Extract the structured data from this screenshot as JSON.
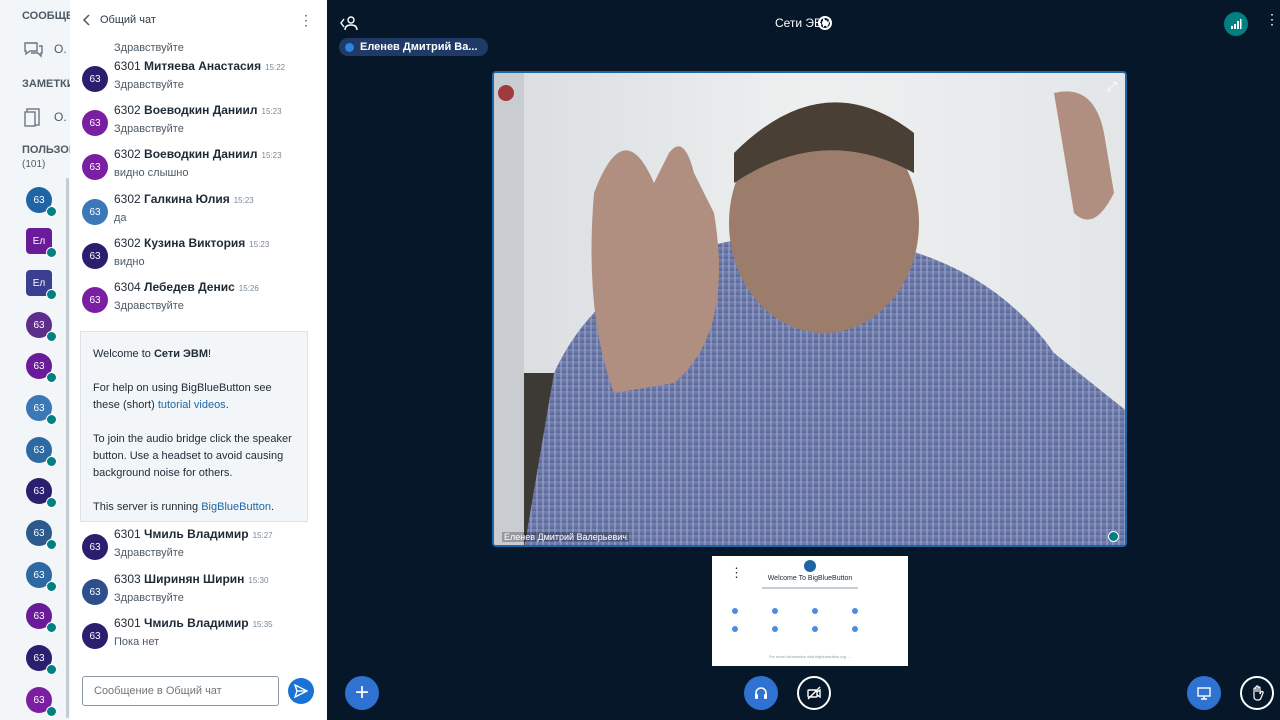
{
  "sidebar": {
    "messages_header": "СООБЩЕН",
    "messages_item_label": "О.",
    "notes_header": "ЗАМЕТКИ",
    "notes_item_label": "О.",
    "users_header": "ПОЛЬЗОВ",
    "users_count": "(101)",
    "users": [
      {
        "initials": "63",
        "color": "#1f65a6"
      },
      {
        "initials": "Ел",
        "color": "#6a1b9a"
      },
      {
        "initials": "Ел",
        "color": "#3b3f8f"
      },
      {
        "initials": "63",
        "color": "#5e2e8c"
      },
      {
        "initials": "63",
        "color": "#6a1b9a"
      },
      {
        "initials": "63",
        "color": "#3a78b8"
      },
      {
        "initials": "63",
        "color": "#2d6aa3"
      },
      {
        "initials": "63",
        "color": "#2a1f6e"
      },
      {
        "initials": "63",
        "color": "#2d5a8c"
      },
      {
        "initials": "63",
        "color": "#2d6aa3"
      },
      {
        "initials": "63",
        "color": "#6a1b9a"
      },
      {
        "initials": "63",
        "color": "#2a1f6e"
      },
      {
        "initials": "63",
        "color": "#7b1fa2"
      }
    ]
  },
  "chat": {
    "title": "Общий чат",
    "cut_message": "Здравствуйте",
    "messages": [
      {
        "initials": "63",
        "color": "#2a1f6e",
        "group": "6301",
        "name": "Митяева Анастасия",
        "time": "15:22",
        "text": "Здравствуйте"
      },
      {
        "initials": "63",
        "color": "#7b1fa2",
        "group": "6302",
        "name": "Воеводкин Даниил",
        "time": "15:23",
        "text": "Здравствуйте"
      },
      {
        "initials": "63",
        "color": "#7b1fa2",
        "group": "6302",
        "name": "Воеводкин Даниил",
        "time": "15:23",
        "text": "видно слышно"
      },
      {
        "initials": "63",
        "color": "#3a78b8",
        "group": "6302",
        "name": "Галкина Юлия",
        "time": "15:23",
        "text": "да"
      },
      {
        "initials": "63",
        "color": "#2a1f6e",
        "group": "6302",
        "name": "Кузина Виктория",
        "time": "15:23",
        "text": "видно"
      },
      {
        "initials": "63",
        "color": "#7b1fa2",
        "group": "6304",
        "name": "Лебедев Денис",
        "time": "15:26",
        "text": "Здравствуйте"
      },
      {
        "initials": "63",
        "color": "#2a1f6e",
        "group": "6301",
        "name": "Чмиль Владимир",
        "time": "15:27",
        "text": "Здравствуйте"
      },
      {
        "initials": "63",
        "color": "#2d4f8c",
        "group": "6303",
        "name": "Ширинян Ширин",
        "time": "15:30",
        "text": "Здравствуйте"
      },
      {
        "initials": "63",
        "color": "#2a1f6e",
        "group": "6301",
        "name": "Чмиль Владимир",
        "time": "15:35",
        "text": "Пока нет"
      }
    ],
    "welcome": {
      "line1_prefix": "Welcome to ",
      "line1_room": "Сети ЭВМ",
      "line1_suffix": "!",
      "line2_prefix": "For help on using BigBlueButton see these (short) ",
      "line2_link": "tutorial videos",
      "line2_suffix": ".",
      "line3": "To join the audio bridge click the speaker button. Use a headset to avoid causing background noise for others.",
      "line4_prefix": "This server is running ",
      "line4_link": "BigBlueButton",
      "line4_suffix": "."
    },
    "input_placeholder": "Сообщение в Общий чат"
  },
  "main": {
    "room_title": "Сети ЭВМ",
    "talking_indicator": "Еленев Дмитрий Ва...",
    "video_name": "Еленев Дмитрий Валерьевич",
    "slide_title": "Welcome To BigBlueButton",
    "slide_footer": "For more information visit bigbluebutton.org →"
  },
  "colors": {
    "accent": "#2f72d1",
    "background": "#06172a",
    "mic_active": "#008081"
  }
}
